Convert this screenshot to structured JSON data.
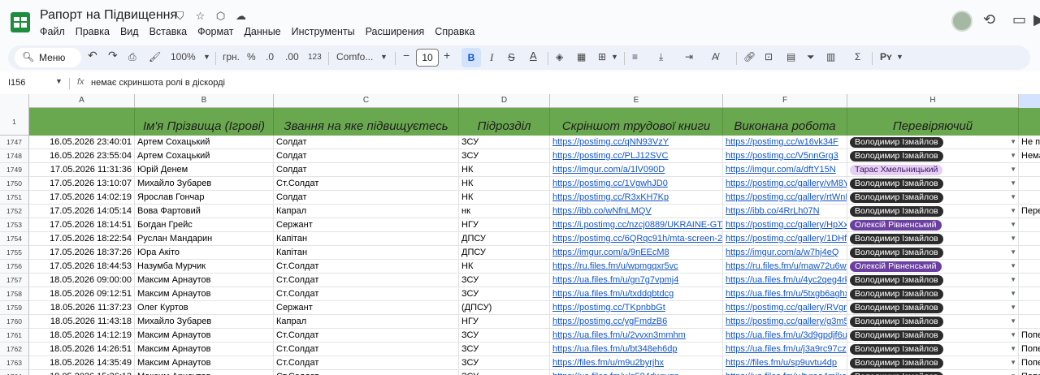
{
  "document": {
    "title": "Рапорт на Підвищення",
    "menu": [
      "Файл",
      "Правка",
      "Вид",
      "Вставка",
      "Формат",
      "Данные",
      "Инструменты",
      "Расширения",
      "Справка"
    ]
  },
  "toolbar": {
    "search_label": "Меню",
    "zoom": "100%",
    "currency": "грн.",
    "percent": "%",
    "decrease_decimals": ".0",
    "increase_decimals": ".00",
    "number_format": "123",
    "font_name": "Comfo...",
    "font_size": "10",
    "bold": "B",
    "italic": "I",
    "text_color": "A",
    "sum": "Σ",
    "input_tools": "Рʏ"
  },
  "formula_bar": {
    "cell_ref": "I156",
    "fx": "fx",
    "formula": "немає скриншота ролі в діскорді"
  },
  "columns": [
    "A",
    "B",
    "C",
    "D",
    "E",
    "F",
    "H"
  ],
  "header_row": {
    "row_number": "1",
    "cells": [
      "",
      "Ім'я Прізвища (Ігрові)",
      "Звання на яке підвищуєтесь",
      "Підрозділ",
      "Скріншот трудової книги",
      "Виконана робота",
      "Перевіряючий"
    ]
  },
  "chip_colors": {
    "dark": "#2b2b2b",
    "purple": "#6b3fa0",
    "lilac": "#e5cff2"
  },
  "rows": [
    {
      "n": "1747",
      "date": "16.05.2026 23:40:01",
      "name": "Артем Сохацький",
      "rank": "Солдат",
      "unit": "ЗСУ",
      "screenshot": "https://postimg.cc/qNN93VzY",
      "work": "https://postimg.cc/w16vk34F",
      "reviewer": "Володимир Ізмайлов",
      "chip": "dark",
      "extra": "Не п"
    },
    {
      "n": "1748",
      "date": "16.05.2026 23:55:04",
      "name": "Артем Сохацький",
      "rank": "Солдат",
      "unit": "ЗСУ",
      "screenshot": "https://postimg.cc/PLJ12SVC",
      "work": "https://postimg.cc/V5nnGrg3",
      "reviewer": "Володимир Ізмайлов",
      "chip": "dark",
      "extra": "Нема"
    },
    {
      "n": "1749",
      "date": "17.05.2026 11:31:36",
      "name": "Юрій Денем",
      "rank": "Солдат",
      "unit": "НК",
      "screenshot": "https://imgur.com/a/1lV090D",
      "work": "https://imgur.com/a/dftY15N",
      "reviewer": "Тарас Хмельницький",
      "chip": "lilac",
      "extra": ""
    },
    {
      "n": "1750",
      "date": "17.05.2026 13:10:07",
      "name": "Михайло Зубарев",
      "rank": "Ст.Солдат",
      "unit": "НК",
      "screenshot": "https://postimg.cc/1VgwhJD0",
      "work": "https://postimg.cc/gallery/vM8Yf",
      "reviewer": "Володимир Ізмайлов",
      "chip": "dark",
      "extra": ""
    },
    {
      "n": "1751",
      "date": "17.05.2026 14:02:19",
      "name": "Ярослав Гончар",
      "rank": "Солдат",
      "unit": "НК",
      "screenshot": "https://postimg.cc/R3xKH7Kp",
      "work": "https://postimg.cc/gallery/rtWnF",
      "reviewer": "Володимир Ізмайлов",
      "chip": "dark",
      "extra": ""
    },
    {
      "n": "1752",
      "date": "17.05.2026 14:05:14",
      "name": "Вова Фартовий",
      "rank": "Капрал",
      "unit": "нк",
      "screenshot": "https://ibb.co/wNfnLMQV",
      "work": "https://ibb.co/4RrLh07N",
      "reviewer": "Володимир Ізмайлов",
      "chip": "dark",
      "extra": "Пере"
    },
    {
      "n": "1753",
      "date": "17.05.2026 18:14:51",
      "name": "Богдан Грейс",
      "rank": "Сержант",
      "unit": "НГУ",
      "screenshot": "https://i.postimg.cc/nzcj0889/UKRAINE-GTA-",
      "work": "https://postimg.cc/gallery/HpXx7",
      "reviewer": "Олексій Рівненський",
      "chip": "purple",
      "extra": ""
    },
    {
      "n": "1754",
      "date": "17.05.2026 18:22:54",
      "name": "Руслан Мандарин",
      "rank": "Капітан",
      "unit": "ДПСУ",
      "screenshot": "https://postimg.cc/6QRqc91h/mta-screen-20",
      "work": "https://postimg.cc/gallery/1DHfM",
      "reviewer": "Володимир Ізмайлов",
      "chip": "dark",
      "extra": ""
    },
    {
      "n": "1755",
      "date": "17.05.2026 18:37:26",
      "name": "Юра Акіто",
      "rank": "Капітан",
      "unit": "ДПСУ",
      "screenshot": "https://imgur.com/a/9nEEcM8",
      "work": "https://imgur.com/a/w7hj4eQ",
      "reviewer": "Володимир Ізмайлов",
      "chip": "dark",
      "extra": ""
    },
    {
      "n": "1756",
      "date": "17.05.2026 18:44:53",
      "name": "Назумба Мурчик",
      "rank": "Ст.Солдат",
      "unit": "НК",
      "screenshot": "https://ru.files.fm/u/wpmgqxr5vc",
      "work": "https://ru.files.fm/u/maw72u6wv",
      "reviewer": "Олексій Рівненський",
      "chip": "purple",
      "extra": ""
    },
    {
      "n": "1757",
      "date": "18.05.2026 09:00:00",
      "name": "Максим Арнаутов",
      "rank": "Ст.Солдат",
      "unit": "ЗСУ",
      "screenshot": "https://ua.files.fm/u/gn7g7vpmj4",
      "work": "https://ua.files.fm/u/4yc2qeg4rk",
      "reviewer": "Володимир Ізмайлов",
      "chip": "dark",
      "extra": ""
    },
    {
      "n": "1758",
      "date": "18.05.2026 09:12:51",
      "name": "Максим Арнаутов",
      "rank": "Ст.Солдат",
      "unit": "ЗСУ",
      "screenshot": "https://ua.files.fm/u/txddqbtdcg",
      "work": "https://ua.files.fm/u/5txgb6aghx",
      "reviewer": "Володимир Ізмайлов",
      "chip": "dark",
      "extra": ""
    },
    {
      "n": "1759",
      "date": "18.05.2026 11:37:23",
      "name": "Олег Куртов",
      "rank": "Сержант",
      "unit": "(ДПСУ)",
      "screenshot": "https://postimg.cc/TKpnbbGt",
      "work": "https://postimg.cc/gallery/RVgr0",
      "reviewer": "Володимир Ізмайлов",
      "chip": "dark",
      "extra": ""
    },
    {
      "n": "1760",
      "date": "18.05.2026 11:43:18",
      "name": "Михайло Зубарев",
      "rank": "Капрал",
      "unit": "НГУ",
      "screenshot": "https://postimg.cc/ygFmdzB6",
      "work": "https://postimg.cc/gallery/g3m5t",
      "reviewer": "Володимир Ізмайлов",
      "chip": "dark",
      "extra": ""
    },
    {
      "n": "1761",
      "date": "18.05.2026 14:12:19",
      "name": "Максим Арнаутов",
      "rank": "Ст.Солдат",
      "unit": "ЗСУ",
      "screenshot": "https://ua.files.fm/u/2vvxn3mmhm",
      "work": "https://ua.files.fm/u/3d9gpdjf6u",
      "reviewer": "Володимир Ізмайлов",
      "chip": "dark",
      "extra": "Попе"
    },
    {
      "n": "1762",
      "date": "18.05.2026 14:26:51",
      "name": "Максим Арнаутов",
      "rank": "Ст.Солдат",
      "unit": "ЗСУ",
      "screenshot": "https://ua.files.fm/u/bt348eh6dp",
      "work": "https://ua.files.fm/u/j3a9rc97cz",
      "reviewer": "Володимир Ізмайлов",
      "chip": "dark",
      "extra": "Попе"
    },
    {
      "n": "1763",
      "date": "18.05.2026 14:35:49",
      "name": "Максим Арнаутов",
      "rank": "Ст.Солдат",
      "unit": "ЗСУ",
      "screenshot": "https://files.fm/u/m9u2byrjhx",
      "work": "https://files.fm/u/sp9uvtu4dp",
      "reviewer": "Володимир Ізмайлов",
      "chip": "dark",
      "extra": "Попе"
    },
    {
      "n": "1764",
      "date": "18.05.2026 15:26:13",
      "name": "Максим Арнаутов",
      "rank": "Ст.Солдат",
      "unit": "ЗСУ",
      "screenshot": "https://ua.files.fm/u/g584dwrugn",
      "work": "https://ua.files.fm/u/tyraa4mike",
      "reviewer": "Володимир Ізмайлов",
      "chip": "dark",
      "extra": "Попе"
    }
  ]
}
